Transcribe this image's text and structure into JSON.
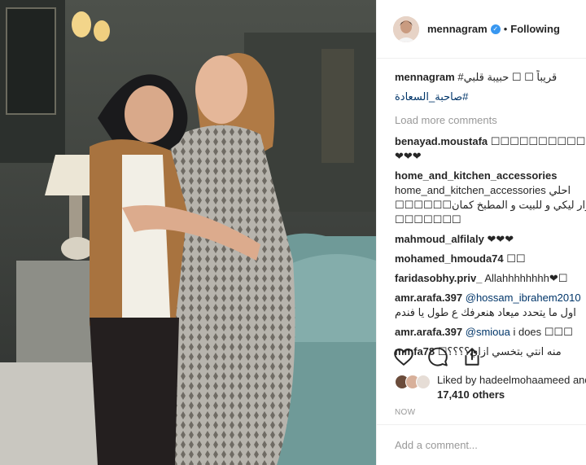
{
  "post": {
    "username": "mennagram",
    "verified_mark": "✓",
    "separator": "•",
    "follow_status": "Following",
    "caption": "#قريباً  ☐ ☐  حبيبة قلبي",
    "caption_tag": "#صاحبة_السعادة",
    "load_more": "Load more comments",
    "comments": [
      {
        "user": "benayad.moustafa",
        "text": "☐☐☐☐☐☐☐☐☐☐☐",
        "text2": "❤❤❤"
      },
      {
        "user": "home_and_kitchen_accessories",
        "text": "home_and_kitchen_accessories احلي",
        "text2": "☐☐☐☐☐☐اكسسوار ليكي و للبيت و المطبخ كمان",
        "text3": "☐☐☐☐☐☐☐"
      },
      {
        "user": "mahmoud_alfilaly",
        "text": "❤❤❤"
      },
      {
        "user": "mohamed_hmouda74",
        "text": "☐☐"
      },
      {
        "user": "faridasobhy.priv_",
        "text": "Allahhhhhhhh❤☐"
      },
      {
        "user": "amr.arafa.397",
        "mention": "@hossam_ibrahem2010",
        "text2": "اول ما يتحدد ميعاد هنعرفك ع طول يا فندم"
      },
      {
        "user": "amr.arafa.397",
        "mention": "@smioua",
        "text": " i does ☐☐☐"
      },
      {
        "user": "mmfa78",
        "text": "☐منه انتي بتخسي ازاي؟؟؟؟"
      }
    ],
    "likes_text": "Liked by hadeelmohaameed and",
    "likes_count": "17,410 others",
    "time": "NOW",
    "add_comment_placeholder": "Add a comment..."
  },
  "colors": {
    "accent": "#3897f0",
    "link": "#003569",
    "muted": "#999999"
  },
  "icons": [
    "heart-icon",
    "comment-icon",
    "share-icon",
    "verified-icon"
  ]
}
